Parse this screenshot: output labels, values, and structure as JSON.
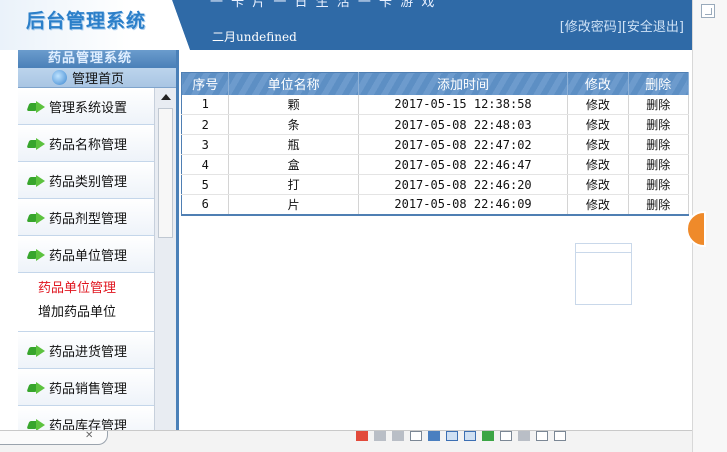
{
  "header": {
    "logo": "后台管理系统",
    "top_strip": "一 卡 片 一 日 生 活 一 卡 游 戏",
    "date_text": "二月undefined",
    "change_password": "[修改密码]",
    "logout": "[安全退出]"
  },
  "sidebar": {
    "title": "药品管理系统",
    "home": "管理首页",
    "items": [
      {
        "label": "管理系统设置"
      },
      {
        "label": "药品名称管理"
      },
      {
        "label": "药品类别管理"
      },
      {
        "label": "药品剂型管理"
      },
      {
        "label": "药品单位管理"
      }
    ],
    "sub_items": [
      {
        "label": "药品单位管理"
      },
      {
        "label": "增加药品单位"
      }
    ],
    "items_after": [
      {
        "label": "药品进货管理"
      },
      {
        "label": "药品销售管理"
      },
      {
        "label": "药品库存管理"
      }
    ]
  },
  "table": {
    "headers": [
      "序号",
      "单位名称",
      "添加时间",
      "修改",
      "删除"
    ],
    "rows": [
      {
        "id": "1",
        "name": "颗",
        "time": "2017-05-15 12:38:58",
        "edit": "修改",
        "delete": "删除"
      },
      {
        "id": "2",
        "name": "条",
        "time": "2017-05-08 22:48:03",
        "edit": "修改",
        "delete": "删除"
      },
      {
        "id": "3",
        "name": "瓶",
        "time": "2017-05-08 22:47:02",
        "edit": "修改",
        "delete": "删除"
      },
      {
        "id": "4",
        "name": "盒",
        "time": "2017-05-08 22:46:47",
        "edit": "修改",
        "delete": "删除"
      },
      {
        "id": "5",
        "name": "打",
        "time": "2017-05-08 22:46:20",
        "edit": "修改",
        "delete": "删除"
      },
      {
        "id": "6",
        "name": "片",
        "time": "2017-05-08 22:46:09",
        "edit": "修改",
        "delete": "删除"
      }
    ]
  },
  "bottom": {
    "tab_close": "✕"
  },
  "colors": {
    "header_blue": "#2f6aa7",
    "table_header_blue": "#5d8fc4",
    "active_red": "#e0141e",
    "badge_orange": "#ef8a2a"
  }
}
